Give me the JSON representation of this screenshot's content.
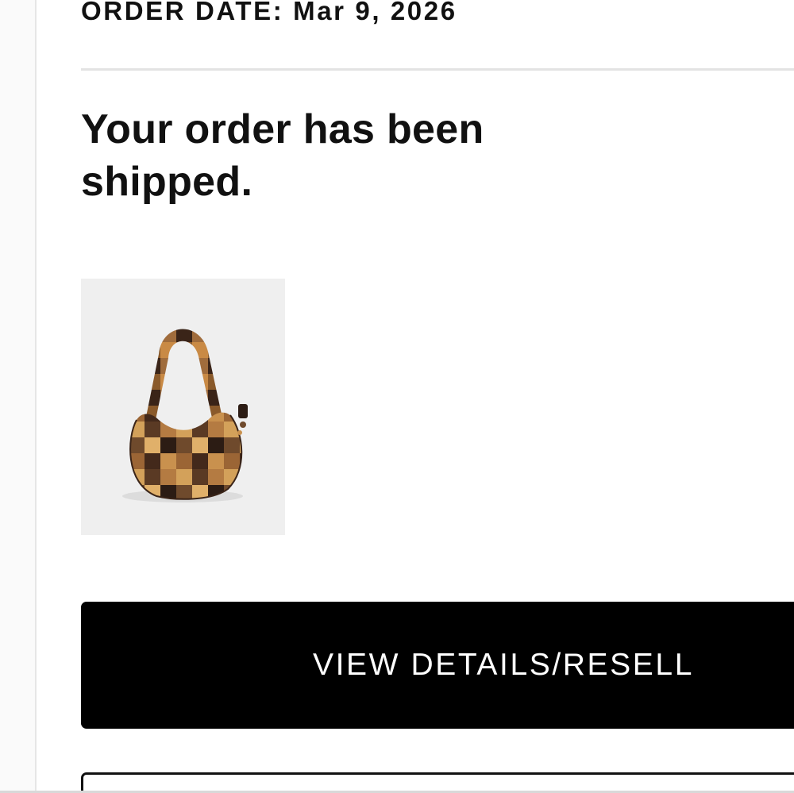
{
  "order": {
    "date_label": "ORDER DATE:",
    "date_value": "Mar 9, 2026"
  },
  "status": {
    "headline": "Your order has been shipped."
  },
  "product": {
    "image_name": "patchwork-hobo-bag-icon",
    "tile_color": "#efefef"
  },
  "actions": {
    "primary_label": "VIEW DETAILS/RESELL",
    "secondary_label": ""
  }
}
